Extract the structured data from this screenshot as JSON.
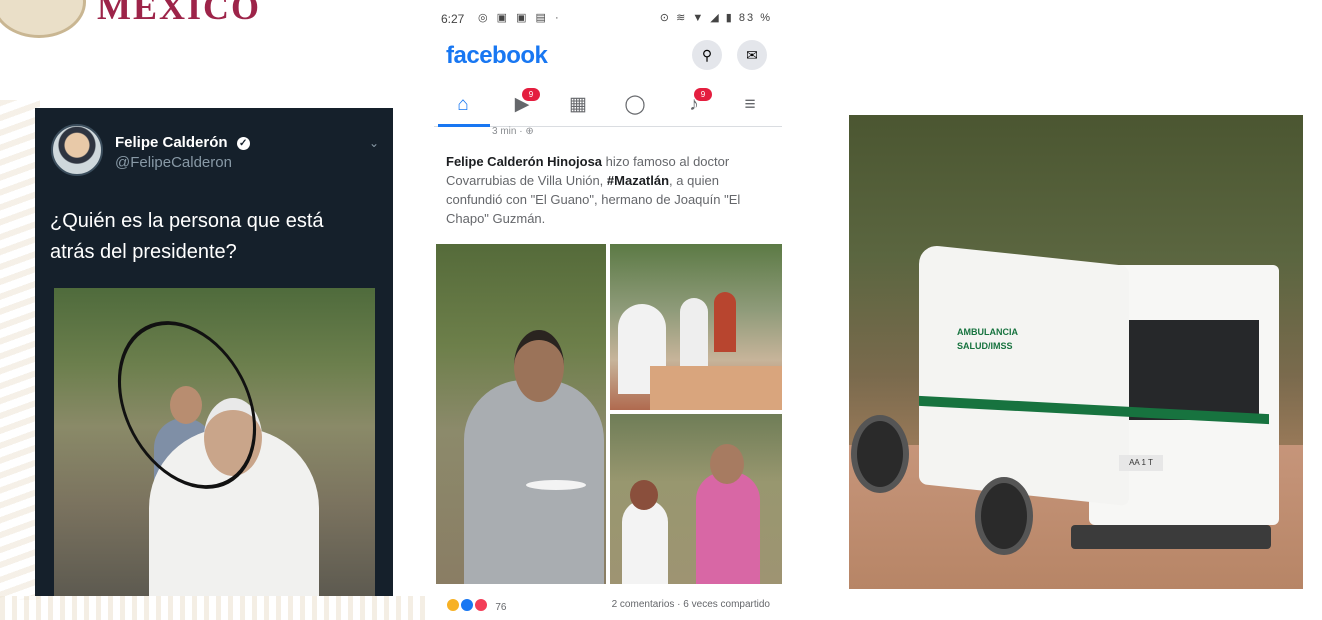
{
  "header": {
    "brand_title": "MEXICO"
  },
  "tweet": {
    "name": "Felipe Calderón",
    "handle": "@FelipeCalderon",
    "text": "¿Quién es la persona que está atrás del presidente?"
  },
  "phone": {
    "status_time": "6:27",
    "status_right": "83 %",
    "app_title": "facebook",
    "nav": [
      {
        "name": "home",
        "badge": ""
      },
      {
        "name": "watch",
        "badge": "9"
      },
      {
        "name": "marketplace",
        "badge": ""
      },
      {
        "name": "profile",
        "badge": ""
      },
      {
        "name": "notifications",
        "badge": "9"
      },
      {
        "name": "menu",
        "badge": ""
      }
    ],
    "post": {
      "time": "3 min · ",
      "author": "Felipe Calderón Hinojosa",
      "text_part1": " hizo famoso al doctor Covarrubias de Villa Unión, ",
      "hashtag": "#Mazatlán",
      "text_part2": ", a quien confundió con \"El Guano\", hermano de Joaquín \"El Chapo\" Guzmán.",
      "reaction_count": "76",
      "stats": "2 comentarios · 6 veces compartido"
    }
  },
  "ambulance": {
    "label": "AMBULANCIA\nSALUD/IMSS",
    "plate": "AA 1 T"
  },
  "colors": {
    "brand": "#9d2449",
    "fb_blue": "#1877f2",
    "twitter_bg": "#15202b",
    "ambulance_green": "#17733f"
  }
}
